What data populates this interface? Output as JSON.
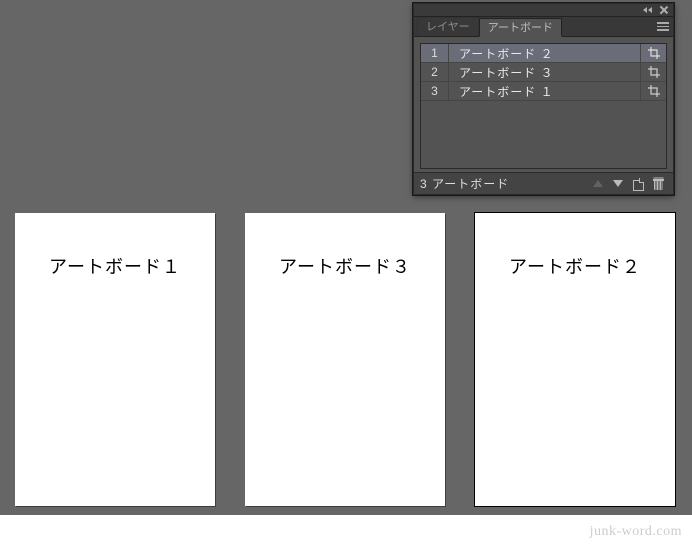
{
  "canvas": {
    "artboards": [
      {
        "label": "アートボード１"
      },
      {
        "label": "アートボード３"
      },
      {
        "label": "アートボード２"
      }
    ]
  },
  "panel": {
    "tabs": {
      "inactive": "レイヤー",
      "active": "アートボード"
    },
    "rows": [
      {
        "num": "1",
        "name": "アートボード ２",
        "selected": true
      },
      {
        "num": "2",
        "name": "アートボード ３",
        "selected": false
      },
      {
        "num": "3",
        "name": "アートボード １",
        "selected": false
      }
    ],
    "status": "3 アートボード"
  },
  "watermark": "junk-word.com"
}
